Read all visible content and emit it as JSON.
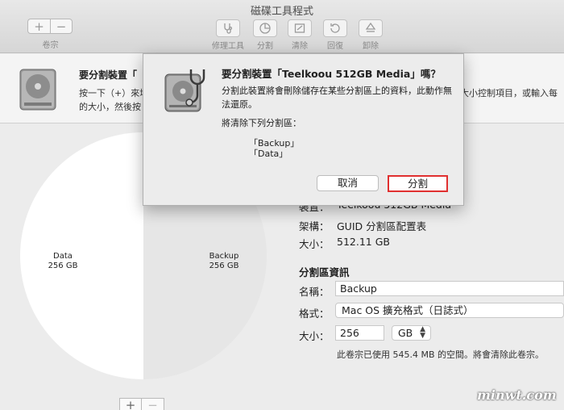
{
  "window": {
    "title": "磁碟工具程式"
  },
  "toolbar": {
    "volume_add": "+",
    "volume_remove": "−",
    "volume_label": "卷宗",
    "first_aid_label": "修理工具",
    "partition_label": "分割",
    "erase_label": "清除",
    "restore_label": "回復",
    "unmount_label": "卸除"
  },
  "info": {
    "title": "要分割裝置「",
    "desc_line1": "按一下（+）來增",
    "desc_line2": "的大小，然後按",
    "desc_right": "大小控制項目，或輸入每"
  },
  "pie": {
    "slices": [
      {
        "name": "Data",
        "size": "256 GB",
        "fraction": 0.5
      },
      {
        "name": "Backup",
        "size": "256 GB",
        "fraction": 0.5
      }
    ]
  },
  "pie_controls": {
    "add": "+",
    "remove": "−"
  },
  "device_props": {
    "device_key": "裝置：",
    "device_value": "Teelkoou 512GB Media",
    "scheme_key": "架構：",
    "scheme_value": "GUID 分割區配置表",
    "size_key": "大小：",
    "size_value": "512.11 GB"
  },
  "partition_info": {
    "title": "分割區資訊",
    "name_key": "名稱：",
    "name_value": "Backup",
    "format_key": "格式：",
    "format_value": "Mac OS 擴充格式（日誌式）",
    "size_key": "大小：",
    "size_value": "256",
    "unit_value": "GB",
    "note": "此卷宗已使用 545.4 MB 的空間。將會清除此卷宗。"
  },
  "dialog": {
    "title": "要分割裝置「Teelkoou 512GB Media」嗎？",
    "message": "分割此裝置將會刪除儲存在某些分割區上的資料，此動作無法還原。",
    "sub": "將清除下列分割區：",
    "items": [
      "「Backup」",
      "「Data」"
    ],
    "cancel": "取消",
    "confirm": "分割"
  },
  "watermark": "minwt.com",
  "colors": {
    "highlight": "#e03030",
    "pie_left": "#ffffff",
    "pie_right": "#e6e6e6"
  }
}
